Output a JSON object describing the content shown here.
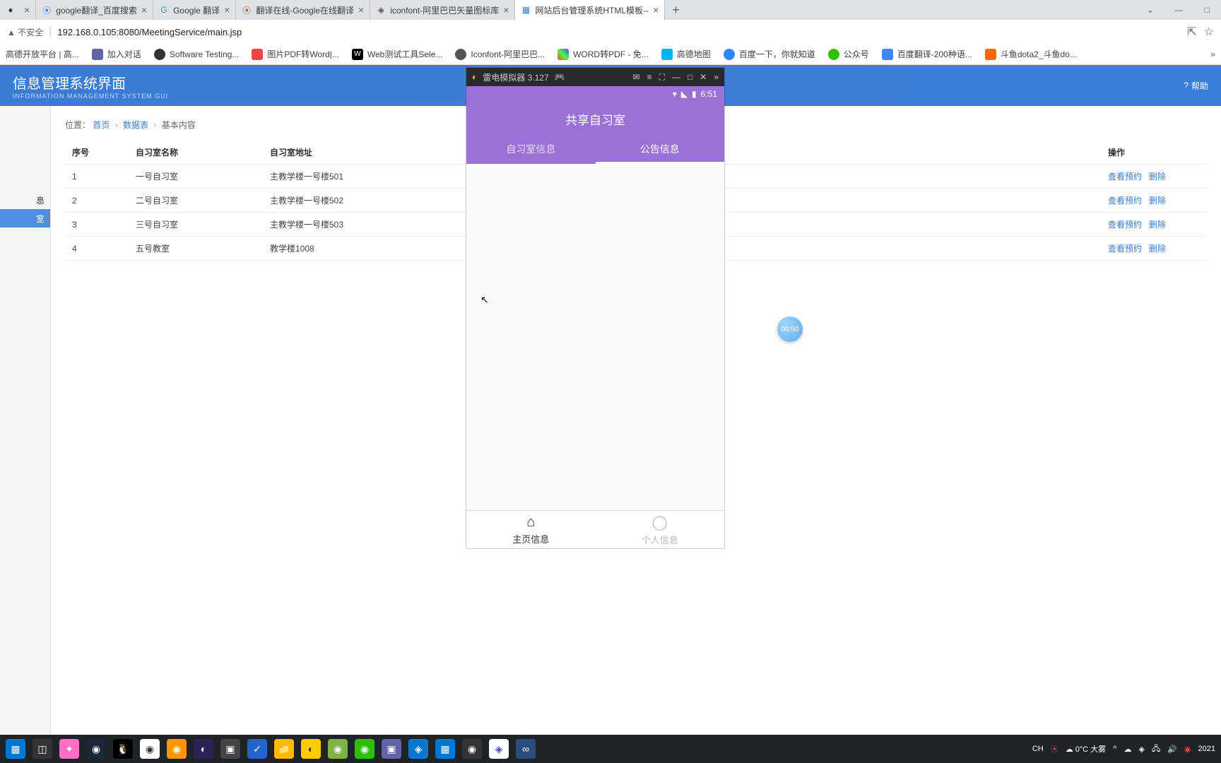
{
  "browser": {
    "tabs": [
      {
        "label": "",
        "active": false
      },
      {
        "label": "google翻译_百度搜索",
        "active": false
      },
      {
        "label": "Google 翻译",
        "active": false
      },
      {
        "label": "翻译在线-Google在线翻译",
        "active": false
      },
      {
        "label": "iconfont-阿里巴巴矢量图标库",
        "active": false
      },
      {
        "label": "网站后台管理系统HTML模板--",
        "active": true
      }
    ],
    "new_tab": "+",
    "address": {
      "warn_icon": "⚠",
      "warn_text": "不安全",
      "url": "192.168.0.105:8080/MeetingService/main.jsp"
    },
    "bookmarks": [
      "高德开放平台 | 高...",
      "加入对话",
      "Software Testing...",
      "图片PDF转Word|...",
      "Web测试工具Sele...",
      "Iconfont-阿里巴巴...",
      "WORD转PDF - 免...",
      "高德地图",
      "百度一下，你就知道",
      "公众号",
      "百度翻译-200种语...",
      "斗鱼dota2_斗鱼do..."
    ],
    "overflow": "»"
  },
  "app": {
    "title": "信息管理系统界面",
    "subtitle": "INFORMATION MANAGEMENT SYSTEM GUI",
    "help": "帮助",
    "sidebar": {
      "items": [
        "息",
        "室"
      ]
    },
    "breadcrumb": {
      "label": "位置：",
      "items": [
        "首页",
        "数据表",
        "基本内容"
      ]
    },
    "table": {
      "headers": [
        "序号",
        "自习室名称",
        "自习室地址",
        "操作"
      ],
      "rows": [
        {
          "no": "1",
          "name": "一号自习室",
          "addr": "主教学楼一号楼501"
        },
        {
          "no": "2",
          "name": "二号自习室",
          "addr": "主教学楼一号楼502"
        },
        {
          "no": "3",
          "name": "三号自习室",
          "addr": "主教学楼一号楼503"
        },
        {
          "no": "4",
          "name": "五号教室",
          "addr": "教学楼1008"
        }
      ],
      "op_view": "查看预约",
      "op_delete": "删除"
    }
  },
  "emulator": {
    "title": "雷电模拟器 3.127",
    "status_time": "6:51",
    "header": "共享自习室",
    "tabs": [
      "自习室信息",
      "公告信息"
    ],
    "bottom": [
      {
        "label": "主页信息",
        "active": true
      },
      {
        "label": "个人信息",
        "active": false
      }
    ]
  },
  "timer": "00:50",
  "taskbar": {
    "weather": "0°C 大雾",
    "ime": "CH",
    "year": "2021"
  }
}
